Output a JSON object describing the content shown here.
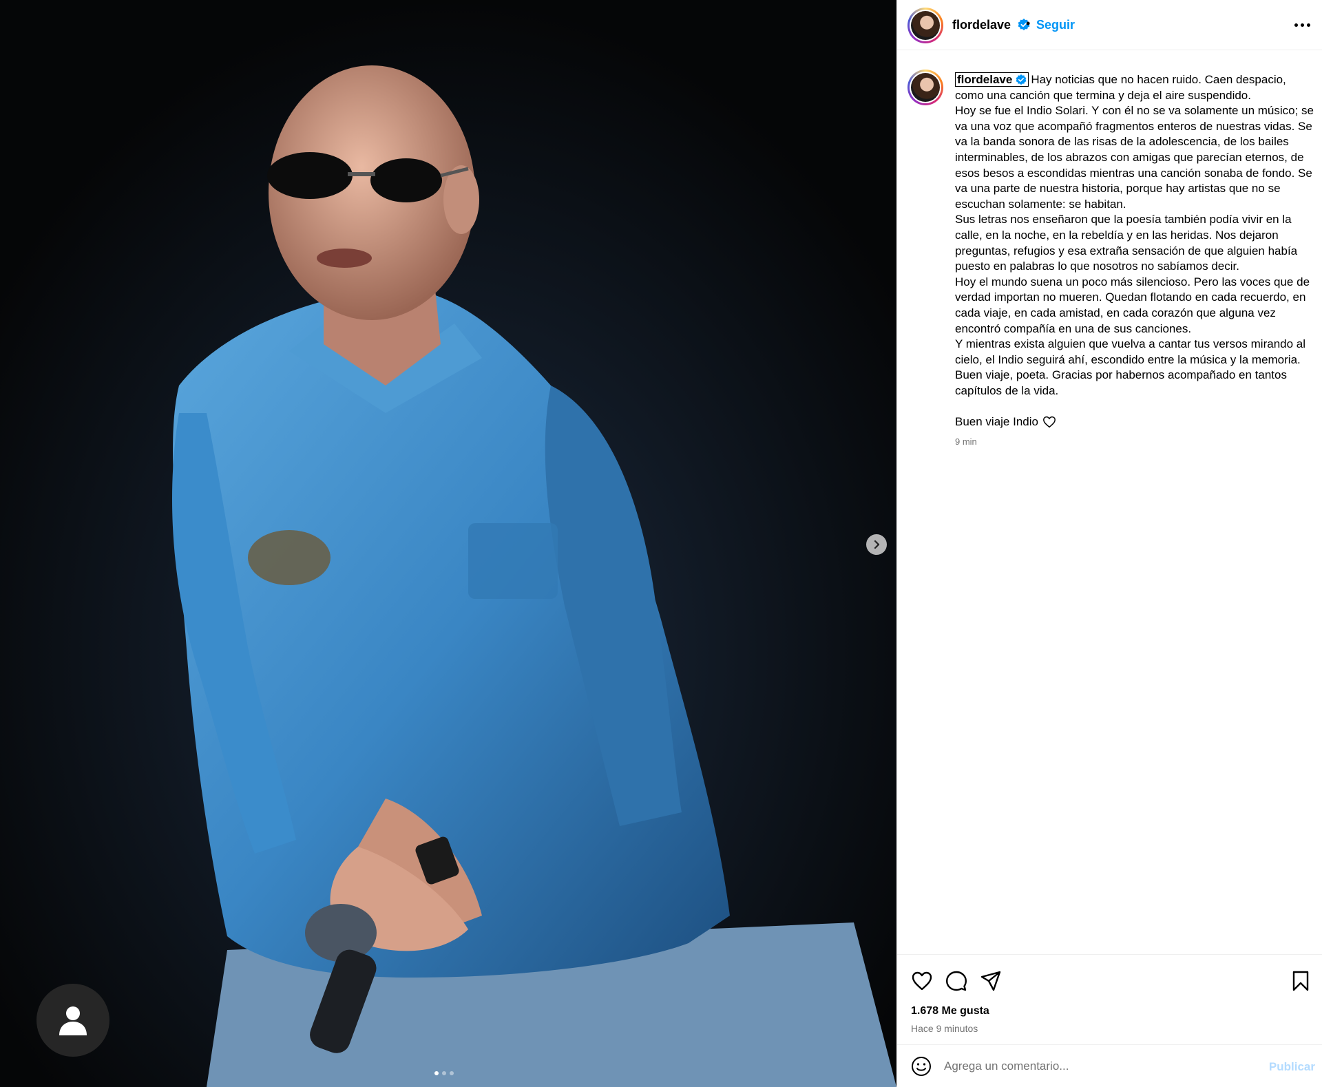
{
  "post": {
    "username": "flordelave",
    "verified": true,
    "follow_label": "Seguir",
    "separator": "•"
  },
  "media": {
    "carousel_count": 3,
    "active_index": 0
  },
  "caption": {
    "username": "flordelave",
    "lines": [
      "Hay noticias que no hacen ruido. Caen despacio, como una canción que termina y deja el aire suspendido.",
      "Hoy se fue el Indio Solari. Y con él no se va solamente un músico; se va una voz que acompañó fragmentos enteros de nuestras vidas. Se va la banda sonora de las risas de la adolescencia, de los bailes interminables, de los abrazos con amigas que parecían eternos, de esos besos a escondidas mientras una canción sonaba de fondo. Se va una parte de nuestra historia, porque hay artistas que no se escuchan solamente: se habitan.",
      "Sus letras nos enseñaron que la poesía también podía vivir en la calle, en la noche, en la rebeldía y en las heridas. Nos dejaron preguntas, refugios y esa extraña sensación de que alguien había puesto en palabras lo que nosotros no sabíamos decir.",
      "Hoy el mundo suena un poco más silencioso. Pero las voces que de verdad importan no mueren. Quedan flotando en cada recuerdo, en cada viaje, en cada amistad, en cada corazón que alguna vez encontró compañía en una de sus canciones.",
      "Y mientras exista alguien que vuelva a cantar tus versos mirando al cielo, el Indio seguirá ahí, escondido entre la música y la memoria.",
      "Buen viaje, poeta. Gracias por habernos acompañado en tantos capítulos de la vida."
    ],
    "sign_off": "Buen viaje Indio",
    "time": "9 min"
  },
  "stats": {
    "likes": "1.678 Me gusta",
    "time_ago": "Hace 9 minutos"
  },
  "comment": {
    "placeholder": "Agrega un comentario...",
    "publish_label": "Publicar"
  },
  "colors": {
    "accent": "#0095f6",
    "verified": "#0095f6",
    "muted": "#737373",
    "publish_disabled": "#b3dbff",
    "denim": "#3a86c4"
  },
  "icons": [
    "more-icon",
    "verified-icon",
    "chevron-right-icon",
    "user-tag-icon",
    "heart-icon",
    "comment-icon",
    "share-icon",
    "bookmark-icon",
    "emoji-icon"
  ]
}
